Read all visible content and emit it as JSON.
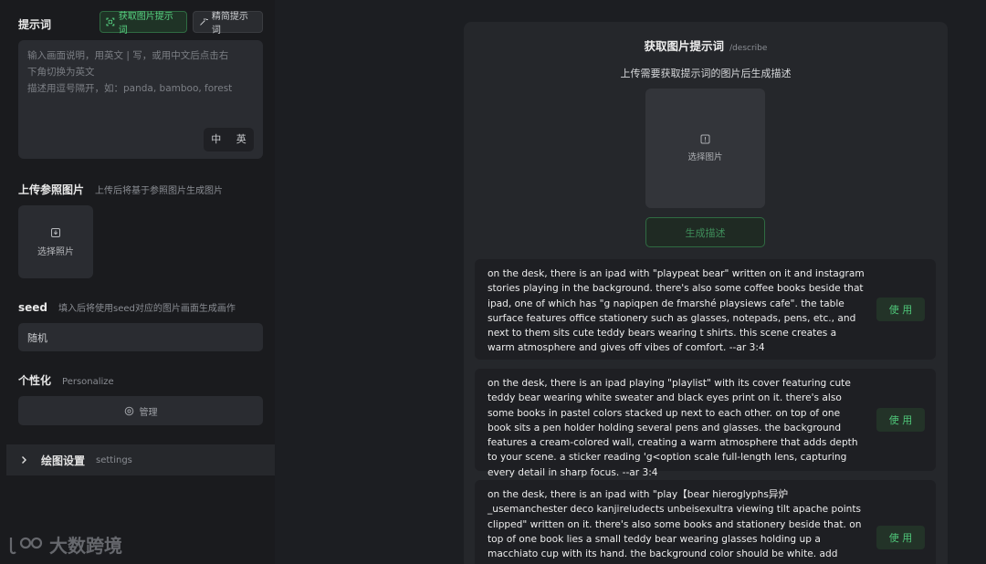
{
  "left": {
    "prompt_title": "提示词",
    "tab_describe": "获取图片提示词",
    "tab_refine": "精简提示词",
    "prompt_placeholder_1": "输入画面说明，用英文 | 写，或用中文后点击右",
    "prompt_placeholder_2": "下角切换为英文",
    "prompt_placeholder_3": "描述用逗号隔开，如：panda, bamboo, forest",
    "lang_zh": "中",
    "lang_en": "英",
    "upload_title": "上传参照图片",
    "upload_sub": "上传后将基于参照图片生成图片",
    "upload_label": "选择照片",
    "seed_title": "seed",
    "seed_sub": "填入后将使用seed对应的图片画面生成画作",
    "seed_value": "随机",
    "personal_title": "个性化",
    "personal_sub": "Personalize",
    "personal_button": "管理",
    "settings_title": "绘图设置",
    "settings_sub": "settings",
    "watermark": "大数跨境"
  },
  "right": {
    "title": "获取图片提示词",
    "command": "/describe",
    "upload_hint": "上传需要获取提示词的图片后生成描述",
    "select_image": "选择图片",
    "generate_button": "生成描述",
    "results": [
      {
        "text": "on the desk, there is an ipad with \"playpeat bear\" written on it and instagram stories playing in the background. there's also some coffee books beside that ipad, one of which has \"g napiqpen de fmarshé playsiews cafe\". the table surface features office stationery such as glasses, notepads, pens, etc., and next to them sits cute teddy bears wearing t shirts. this scene creates a warm atmosphere and gives off vibes of comfort. --ar 3:4",
        "use": "使 用"
      },
      {
        "text": "on the desk, there is an ipad playing \"playlist\" with its cover featuring cute teddy bear wearing white sweater and black eyes print on it. there's also some books in pastel colors stacked up next to each other. on top of one book sits a pen holder holding several pens and glasses. the background features a cream-colored wall, creating a warm atmosphere that adds depth to your scene. a sticker reading 'g<option scale full-length lens, capturing every detail in sharp focus. --ar 3:4",
        "use": "使 用"
      },
      {
        "text": "on the desk, there is an ipad with \"play【bear hieroglyphs异炉_usemanchester deco kanjireludects unbeisexultra viewing tilt apache points clipped\" written on it. there's also some books and stationery beside that. on top of one book lies a small teddy bear wearing glasses holding up a macchiato cup with its hand. the background color should be white. add some books and stationaries around to",
        "use": "使 用"
      }
    ]
  }
}
